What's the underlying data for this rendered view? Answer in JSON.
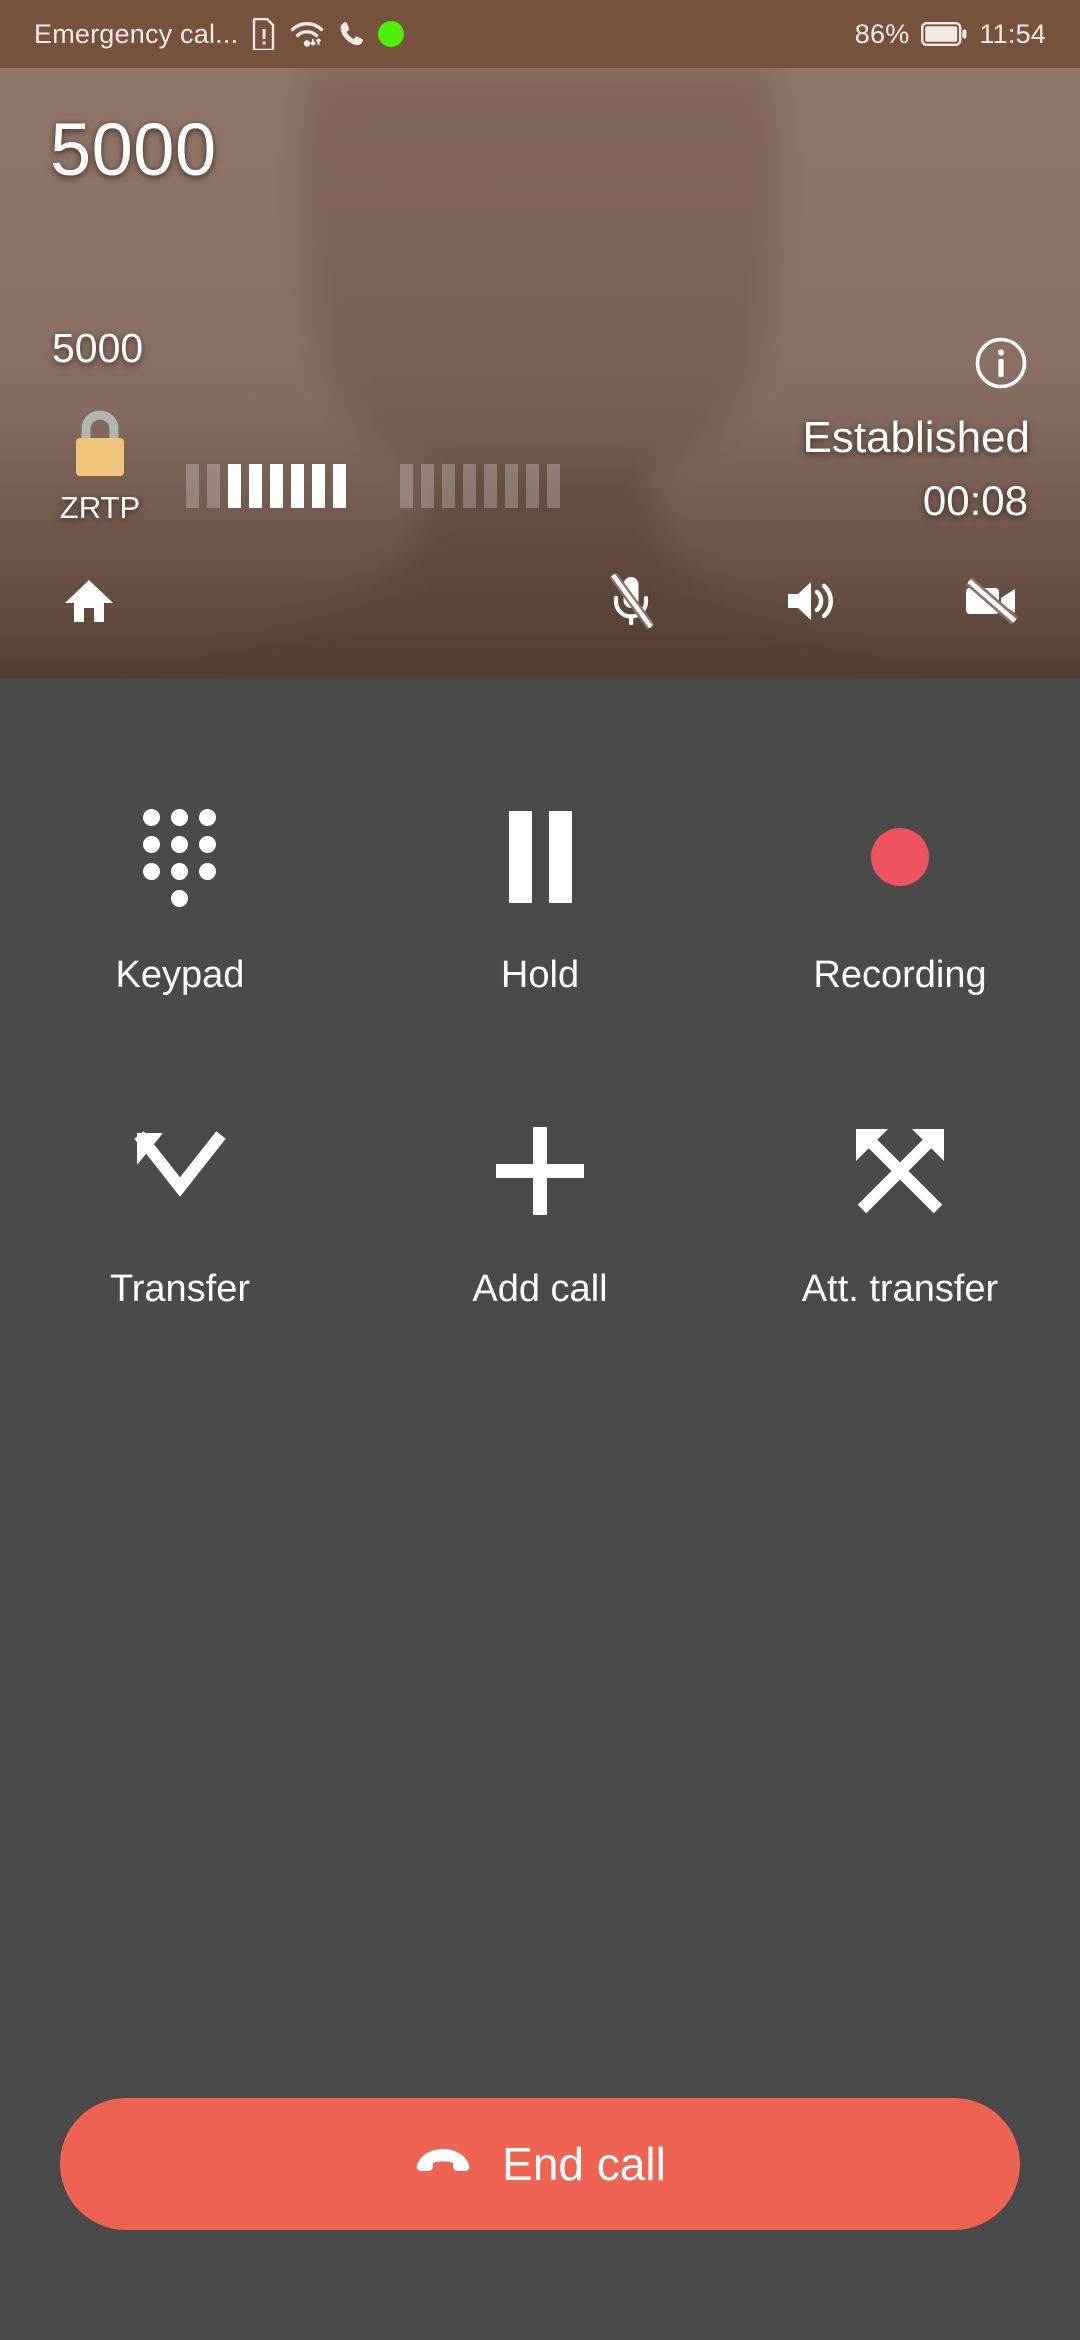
{
  "status_bar": {
    "carrier_text": "Emergency cal...",
    "battery_percent": "86%",
    "clock": "11:54",
    "icons": [
      "sim-alert-icon",
      "wifi-icon",
      "phone-in-call-icon",
      "green-status-dot"
    ]
  },
  "call": {
    "caller_large": "5000",
    "caller_small": "5000",
    "encryption_label": "ZRTP",
    "state": "Established",
    "duration": "00:08",
    "quality_bars_active": 6,
    "quality_bars_left_dim": 2,
    "quality_bars_right_dim": 8,
    "info_icon": "info-circle-icon"
  },
  "header_toolbar": [
    {
      "name": "home",
      "icon": "home-icon",
      "label": "Home",
      "active": false
    },
    {
      "name": "microphone",
      "icon": "mic-off-icon",
      "label": "Mute",
      "active": true
    },
    {
      "name": "speaker",
      "icon": "speaker-on-icon",
      "label": "Speaker",
      "active": false
    },
    {
      "name": "video",
      "icon": "video-off-icon",
      "label": "Video",
      "active": false
    }
  ],
  "actions": [
    {
      "label": "Keypad",
      "icon": "dialpad-icon"
    },
    {
      "label": "Hold",
      "icon": "pause-icon"
    },
    {
      "label": "Recording",
      "icon": "record-dot-icon"
    },
    {
      "label": "Transfer",
      "icon": "call-transfer-icon"
    },
    {
      "label": "Add call",
      "icon": "plus-icon"
    },
    {
      "label": "Att. transfer",
      "icon": "attended-transfer-icon"
    }
  ],
  "end_call": {
    "label": "End call",
    "icon": "call-end-icon"
  },
  "colors": {
    "status_bar_bg": "#75543f",
    "header_bg": "#8d7468",
    "body_bg": "#4a4a4a",
    "end_call_bg": "#ee6352",
    "record_dot": "#ef5361",
    "lock_body": "#f0c479",
    "lock_shackle": "#b0b6b0",
    "status_dot": "#4dee07",
    "text_primary": "#ffffff"
  }
}
